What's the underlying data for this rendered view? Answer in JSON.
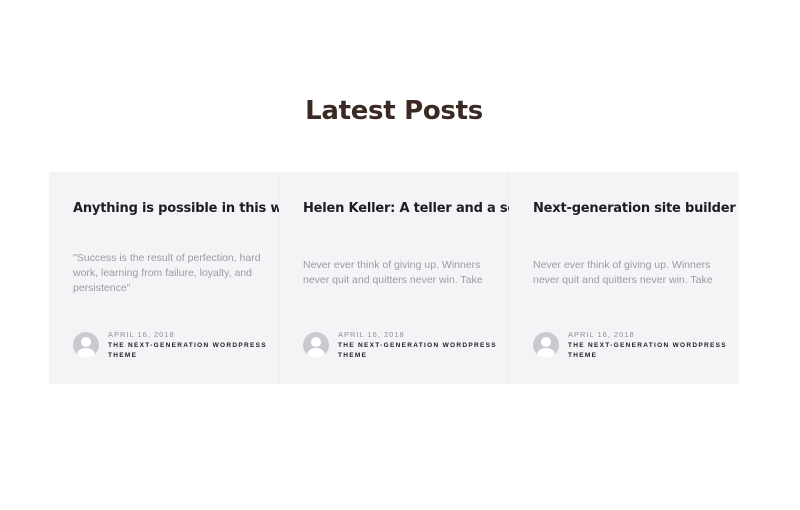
{
  "section": {
    "title": "Latest Posts"
  },
  "posts": [
    {
      "title": "Anything is possible in this world!",
      "excerpt": "\"Success is the result of perfection, hard work, learning from failure, loyalty, and persistence\"",
      "date": "APRIL 16, 2018",
      "source": "THE NEXT-GENERATION WORDPRESS THEME",
      "avatar_icon": "user-avatar-icon"
    },
    {
      "title": "Helen Keller: A teller and a seller",
      "excerpt": "Never ever think of giving up. Winners never quit and quitters never win. Take",
      "date": "APRIL 16, 2018",
      "source": "THE NEXT-GENERATION WORDPRESS THEME",
      "avatar_icon": "user-avatar-icon"
    },
    {
      "title": "Next-generation site builder",
      "excerpt": "Never ever think of giving up. Winners never quit and quitters never win. Take",
      "date": "APRIL 16, 2018",
      "source": "THE NEXT-GENERATION WORDPRESS THEME",
      "avatar_icon": "user-avatar-icon"
    }
  ],
  "colors": {
    "title": "#3b2a23",
    "card_background": "#f3f4f6",
    "excerpt": "#9a9ca3",
    "heading": "#1d1e25"
  }
}
